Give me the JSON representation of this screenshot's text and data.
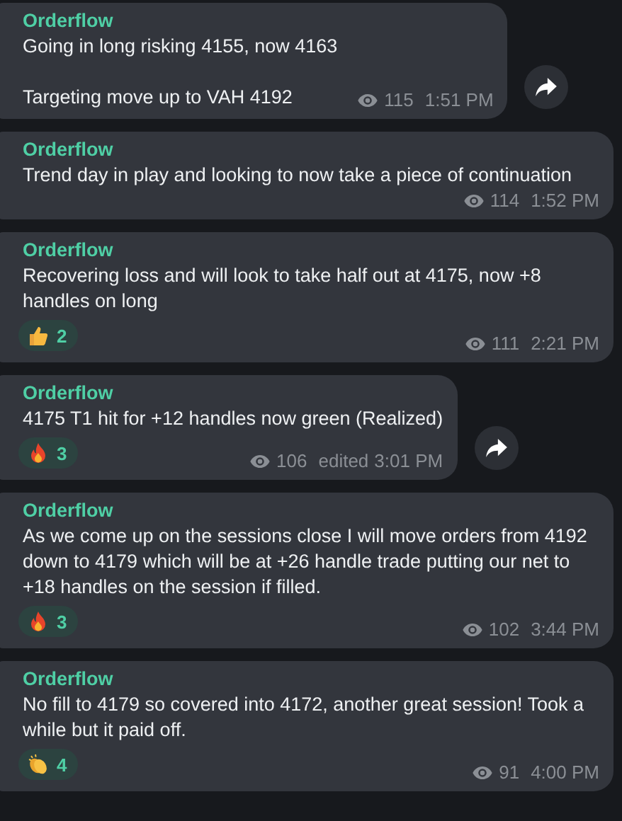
{
  "messages": [
    {
      "sender": "Orderflow",
      "text": "Going in long risking 4155, now 4163\n\nTargeting move up to VAH 4192",
      "views": "115",
      "time": "1:51 PM",
      "forward_button": true
    },
    {
      "sender": "Orderflow",
      "text": "Trend day in play and looking to now take a piece of continuation",
      "views": "114",
      "time": "1:52 PM",
      "forward_button": false
    },
    {
      "sender": "Orderflow",
      "text": "Recovering loss and will look to take half out at 4175, now +8 handles on long",
      "reactions": [
        {
          "kind": "thumbs_up",
          "count": "2"
        }
      ],
      "views": "111",
      "time": "2:21 PM",
      "forward_button": false
    },
    {
      "sender": "Orderflow",
      "text": "4175 T1 hit for +12 handles now green (Realized)",
      "reactions": [
        {
          "kind": "fire",
          "count": "3"
        }
      ],
      "views": "106",
      "edited_label": "edited",
      "time": "3:01 PM",
      "forward_button": true
    },
    {
      "sender": "Orderflow",
      "text": "As we come up on the sessions close I will move orders from 4192 down to 4179 which will be at +26 handle trade putting our net to +18 handles on the session if filled.",
      "reactions": [
        {
          "kind": "fire",
          "count": "3"
        }
      ],
      "views": "102",
      "time": "3:44 PM",
      "forward_button": false
    },
    {
      "sender": "Orderflow",
      "text": "No fill to 4179 so covered into 4172, another great session! Took a while but it paid off.",
      "reactions": [
        {
          "kind": "clap",
          "count": "4"
        }
      ],
      "views": "91",
      "time": "4:00 PM",
      "forward_button": false
    }
  ]
}
